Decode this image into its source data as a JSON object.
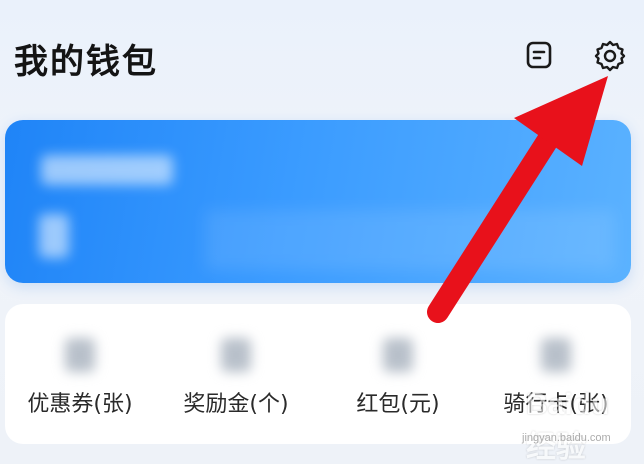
{
  "header": {
    "title": "我的钱包",
    "bill_icon": "bill-icon",
    "settings_icon": "gear-icon"
  },
  "balance_card": {
    "label": "",
    "amount": ""
  },
  "stats": [
    {
      "value": "",
      "label": "优惠券(张)"
    },
    {
      "value": "",
      "label": "奖励金(个)"
    },
    {
      "value": "",
      "label": "红包(元)"
    },
    {
      "value": "",
      "label": "骑行卡(张)"
    }
  ],
  "annotation": {
    "type": "arrow",
    "color": "#e8111b",
    "points_to": "settings-button"
  },
  "watermark": {
    "text": "Baidu经验",
    "sub": "jingyan.baidu.com"
  },
  "colors": {
    "card_start": "#1f84f7",
    "card_end": "#5bb2ff",
    "arrow": "#e8111b"
  }
}
